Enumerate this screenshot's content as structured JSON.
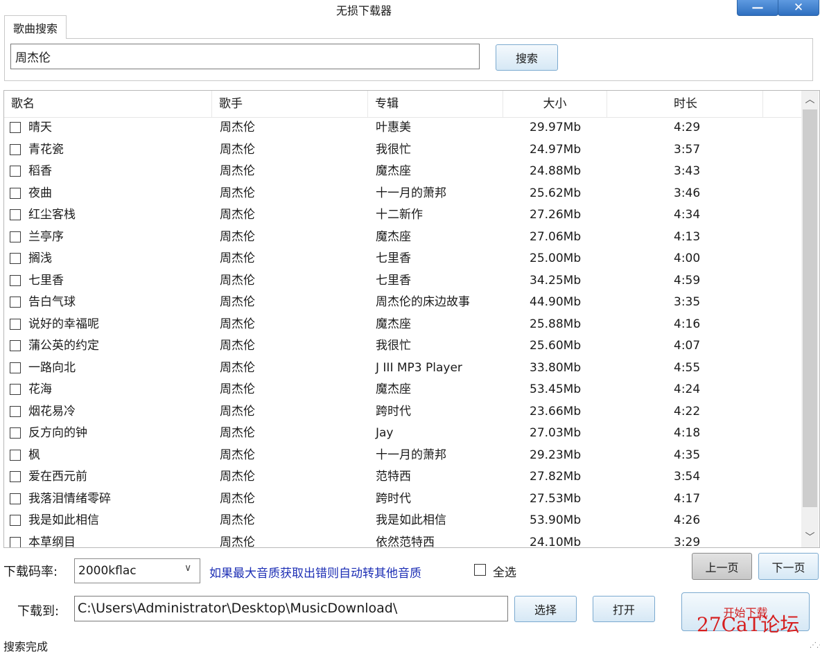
{
  "window": {
    "title": "无损下载器",
    "minimize": "—",
    "close": "✕"
  },
  "tab": {
    "label": "歌曲搜索"
  },
  "search": {
    "value": "周杰伦",
    "button": "搜索"
  },
  "list": {
    "columns": [
      "歌名",
      "歌手",
      "专辑",
      "大小",
      "时长"
    ],
    "rows": [
      [
        "晴天",
        "周杰伦",
        "叶惠美",
        "29.97Mb",
        "4:29"
      ],
      [
        "青花瓷",
        "周杰伦",
        "我很忙",
        "24.97Mb",
        "3:57"
      ],
      [
        "稻香",
        "周杰伦",
        "魔杰座",
        "24.88Mb",
        "3:43"
      ],
      [
        "夜曲",
        "周杰伦",
        "十一月的萧邦",
        "25.62Mb",
        "3:46"
      ],
      [
        "红尘客栈",
        "周杰伦",
        "十二新作",
        "27.26Mb",
        "4:34"
      ],
      [
        "兰亭序",
        "周杰伦",
        "魔杰座",
        "27.06Mb",
        "4:13"
      ],
      [
        "搁浅",
        "周杰伦",
        "七里香",
        "25.00Mb",
        "4:00"
      ],
      [
        "七里香",
        "周杰伦",
        "七里香",
        "34.25Mb",
        "4:59"
      ],
      [
        "告白气球",
        "周杰伦",
        "周杰伦的床边故事",
        "44.90Mb",
        "3:35"
      ],
      [
        "说好的幸福呢",
        "周杰伦",
        "魔杰座",
        "25.88Mb",
        "4:16"
      ],
      [
        "蒲公英的约定",
        "周杰伦",
        "我很忙",
        "25.60Mb",
        "4:07"
      ],
      [
        "一路向北",
        "周杰伦",
        "J III MP3 Player",
        "33.80Mb",
        "4:55"
      ],
      [
        "花海",
        "周杰伦",
        "魔杰座",
        "53.45Mb",
        "4:24"
      ],
      [
        "烟花易冷",
        "周杰伦",
        "跨时代",
        "23.66Mb",
        "4:22"
      ],
      [
        "反方向的钟",
        "周杰伦",
        "Jay",
        "27.03Mb",
        "4:18"
      ],
      [
        "枫",
        "周杰伦",
        "十一月的萧邦",
        "29.23Mb",
        "4:35"
      ],
      [
        "爱在西元前",
        "周杰伦",
        "范特西",
        "27.82Mb",
        "3:54"
      ],
      [
        "我落泪情绪零碎",
        "周杰伦",
        "跨时代",
        "27.53Mb",
        "4:17"
      ],
      [
        "我是如此相信",
        "周杰伦",
        "我是如此相信",
        "53.90Mb",
        "4:26"
      ],
      [
        "本草纲目",
        "周杰伦",
        "依然范特西",
        "24.10Mb",
        "3:29"
      ]
    ]
  },
  "controls": {
    "bitrate_label": "下载码率:",
    "bitrate_value": "2000kflac",
    "bitrate_hint": "如果最大音质获取出错则自动转其他音质",
    "select_all": "全选",
    "prev_page": "上一页",
    "next_page": "下一页",
    "saveto_label": "下载到:",
    "path": "C:\\Users\\Administrator\\Desktop\\MusicDownload\\",
    "choose": "选择",
    "open": "打开",
    "start": "开始下载"
  },
  "status": "搜索完成",
  "watermark": "27CaT论坛",
  "icons": {
    "scroll_up": "scroll-up-icon",
    "scroll_down": "scroll-down-icon",
    "dropdown": "chevron-down-icon"
  }
}
